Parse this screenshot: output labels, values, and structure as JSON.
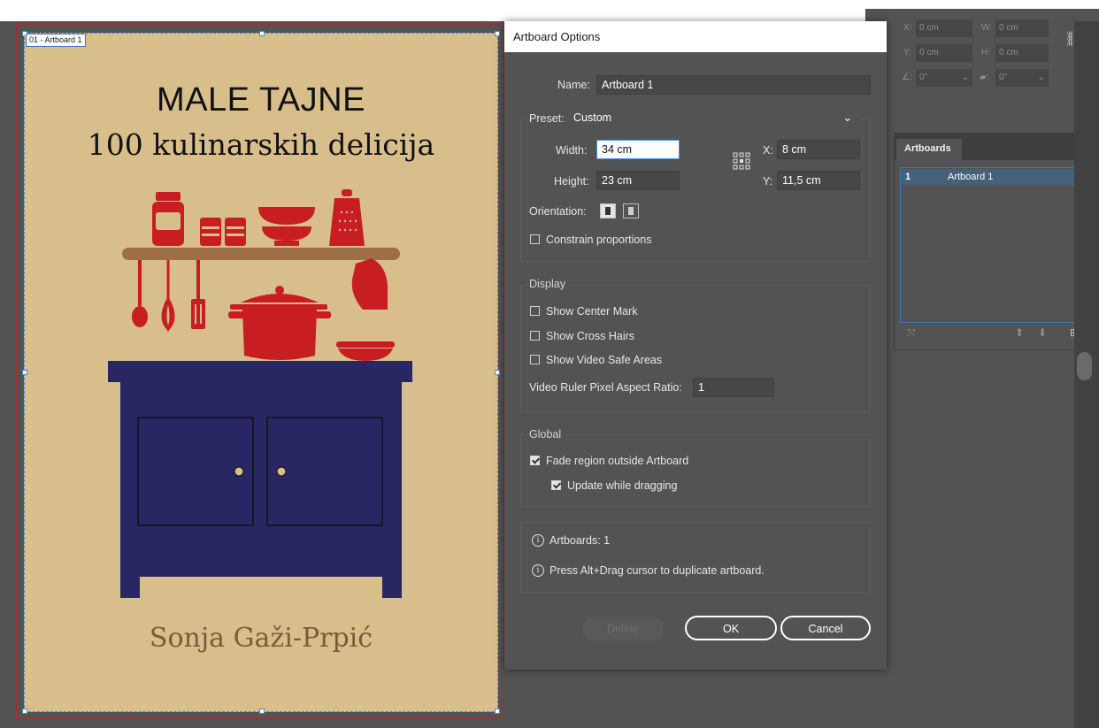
{
  "transform": {
    "x_label": "X:",
    "x_value": "0 cm",
    "y_label": "Y:",
    "y_value": "0 cm",
    "w_label": "W:",
    "w_value": "0 cm",
    "h_label": "H:",
    "h_value": "0 cm",
    "angle_value": "0°",
    "shear_value": "0°"
  },
  "artboard": {
    "label": "01 - Artboard 1",
    "title_line1": "MALE TAJNE",
    "title_line2": "100 kulinarskih delicija",
    "author": "Sonja Gaži-Prpić"
  },
  "dialog": {
    "title": "Artboard Options",
    "name_label": "Name:",
    "name_value": "Artboard 1",
    "preset_label": "Preset:",
    "preset_value": "Custom",
    "width_label": "Width:",
    "width_value": "34 cm",
    "height_label": "Height:",
    "height_value": "23 cm",
    "x_label": "X:",
    "x_value": "8 cm",
    "y_label": "Y:",
    "y_value": "11,5 cm",
    "orientation_label": "Orientation:",
    "constrain_label": "Constrain proportions",
    "constrain_checked": false,
    "display_title": "Display",
    "show_center_mark": "Show Center Mark",
    "show_cross_hairs": "Show Cross Hairs",
    "show_video_safe": "Show Video Safe Areas",
    "video_ratio_label": "Video Ruler Pixel Aspect Ratio:",
    "video_ratio_value": "1",
    "global_title": "Global",
    "fade_region": "Fade region outside Artboard",
    "update_dragging": "Update while dragging",
    "info_artboards": "Artboards: 1",
    "info_duplicate": "Press Alt+Drag cursor to duplicate artboard.",
    "delete_button": "Delete",
    "ok_button": "OK",
    "cancel_button": "Cancel"
  },
  "artboards_panel": {
    "tab_label": "Artboards",
    "rows": [
      {
        "index": "1",
        "name": "Artboard 1"
      }
    ]
  },
  "colors": {
    "artboard_bg": "#d8be8b",
    "kitchen_red": "#c81e23",
    "cabinet_navy": "#282763",
    "shelf_brown": "#9e6f45",
    "author_brown": "#7c5b39"
  }
}
